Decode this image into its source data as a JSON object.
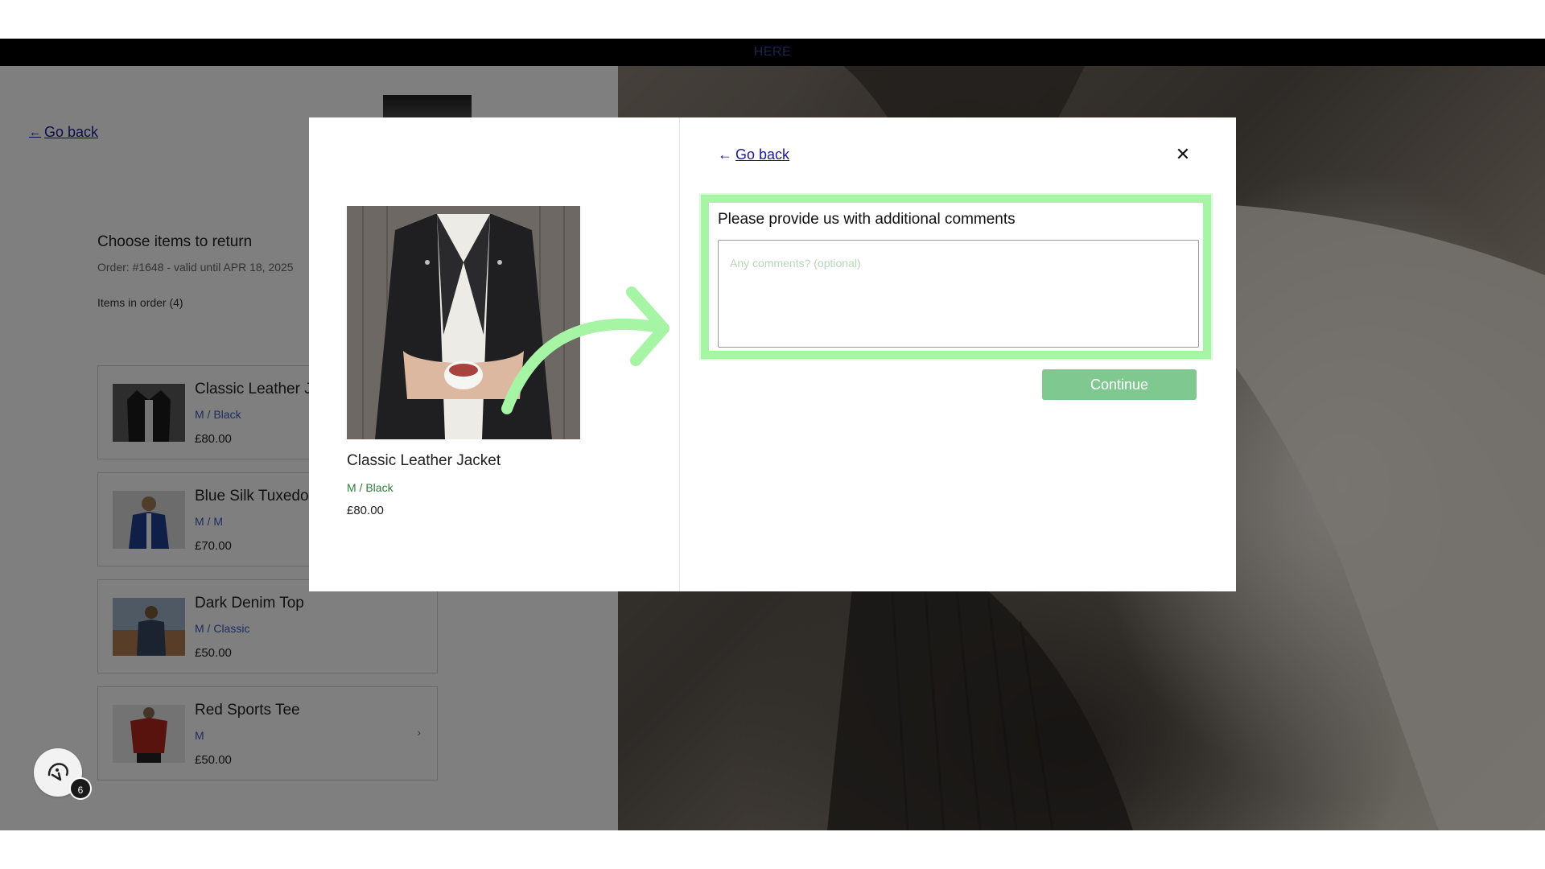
{
  "topbar": {
    "text": "HERE"
  },
  "page": {
    "back_label": "Go back",
    "choose_title": "Choose items to return",
    "order_info": "Order: #1648 - valid until APR 18, 2025",
    "items_count": "Items in order (4)",
    "items": [
      {
        "name": "Classic Leather J",
        "variant": "M / Black",
        "price": "£80.00"
      },
      {
        "name": "Blue Silk Tuxedo",
        "variant": "M / M",
        "price": "£70.00"
      },
      {
        "name": "Dark Denim Top",
        "variant": "M / Classic",
        "price": "£50.00"
      },
      {
        "name": "Red Sports Tee",
        "variant": "M",
        "price": "£50.00",
        "chevron": "›"
      }
    ]
  },
  "modal": {
    "back_label": "Go back",
    "close_glyph": "✕",
    "product": {
      "name": "Classic Leather Jacket",
      "variant": "M / Black",
      "price": "£80.00"
    },
    "comments": {
      "label": "Please provide us with additional comments",
      "placeholder": "Any comments? (optional)",
      "value": ""
    },
    "continue_label": "Continue"
  },
  "chat_widget": {
    "badge_count": "6",
    "icon": "chat-support-icon"
  },
  "colors": {
    "highlight": "#a5f5a5",
    "continue_button": "#7fc991",
    "link": "#1a1a99",
    "variant_green": "#2e7d3a",
    "variant_blue": "#3b5bbf"
  }
}
